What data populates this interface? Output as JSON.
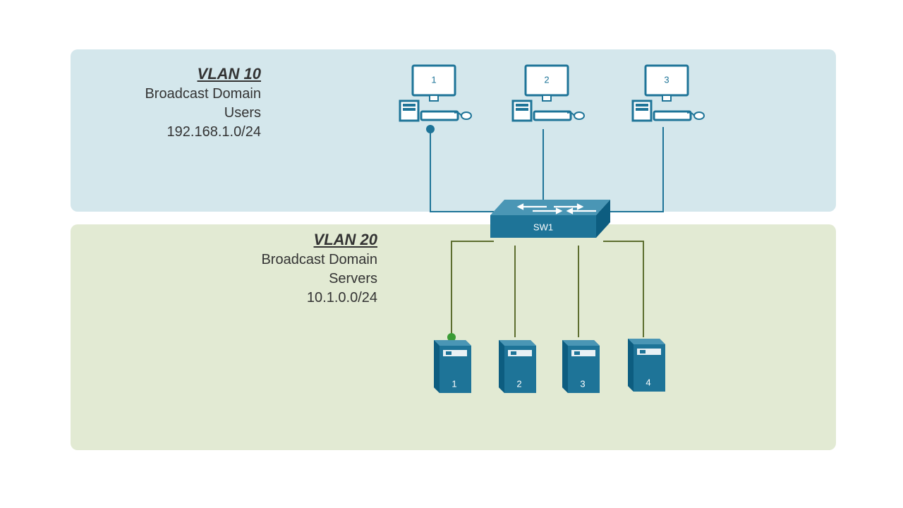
{
  "vlan10": {
    "title": "VLAN 10",
    "line1": "Broadcast Domain",
    "line2": "Users",
    "subnet": "192.168.1.0/24",
    "hosts": [
      "1",
      "2",
      "3"
    ]
  },
  "vlan20": {
    "title": "VLAN 20",
    "line1": "Broadcast Domain",
    "line2": "Servers",
    "subnet": "10.1.0.0/24",
    "hosts": [
      "1",
      "2",
      "3",
      "4"
    ]
  },
  "switch": {
    "label": "SW1"
  },
  "colors": {
    "device": "#1e7498",
    "deviceDark": "#0d5d80",
    "vlan10Line": "#1e7498",
    "vlan20Line": "#5d6e2f",
    "vlan10Dot": "#1e7498",
    "vlan20Dot": "#3a9b35"
  }
}
